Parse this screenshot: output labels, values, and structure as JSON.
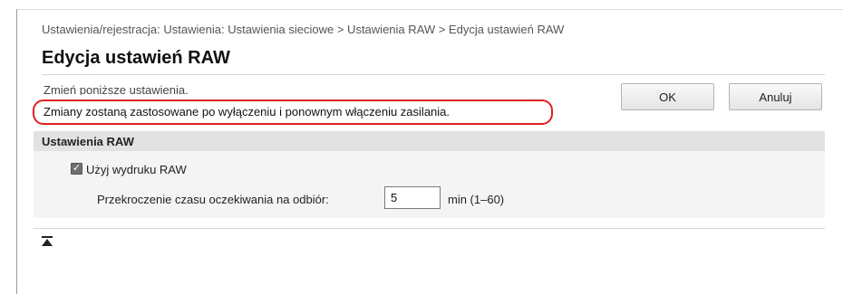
{
  "breadcrumb": "Ustawienia/rejestracja: Ustawienia: Ustawienia sieciowe > Ustawienia RAW > Edycja ustawień RAW",
  "page_title": "Edycja ustawień RAW",
  "hint": "Zmień poniższe ustawienia.",
  "notice": "Zmiany zostaną zastosowane po wyłączeniu i ponownym włączeniu zasilania.",
  "buttons": {
    "ok": "OK",
    "cancel": "Anuluj"
  },
  "section": {
    "title": "Ustawienia RAW",
    "use_raw": {
      "label": "Użyj wydruku RAW",
      "checked": true
    },
    "timeout": {
      "label": "Przekroczenie czasu oczekiwania na odbiór:",
      "value": "5",
      "unit": "min (1–60)"
    }
  },
  "icons": {
    "back_to_top": "back-to-top-icon",
    "checkmark": "checkmark-icon"
  },
  "colors": {
    "notice_outline": "#e02020",
    "section_header_bg": "#e2e2e2",
    "section_body_bg": "#f4f4f4"
  }
}
